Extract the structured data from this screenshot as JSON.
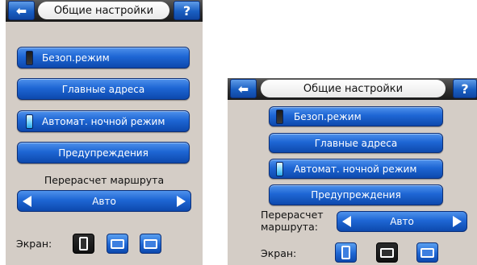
{
  "panel_a": {
    "title": "Общие настройки",
    "back_icon": "arrow-left-icon",
    "help_label": "?",
    "safe_mode_label": "Безоп.режим",
    "main_addresses_label": "Главные адреса",
    "night_mode_label": "Автомат. ночной режим",
    "warnings_label": "Предупреждения",
    "route_recalc_label": "Перерасчет маршрута",
    "route_recalc_value": "Авто",
    "screen_label": "Экран:"
  },
  "panel_b": {
    "title": "Общие настройки",
    "back_icon": "arrow-left-icon",
    "help_label": "?",
    "safe_mode_label": "Безоп.режим",
    "main_addresses_label": "Главные адреса",
    "night_mode_label": "Автомат. ночной режим",
    "warnings_label": "Предупреждения",
    "route_recalc_label_line1": "Перерасчет",
    "route_recalc_label_line2": "маршрута:",
    "route_recalc_value": "Авто",
    "screen_label": "Экран:"
  },
  "toggles": {
    "safe_mode": "off",
    "night_mode": "on"
  },
  "colors": {
    "button_blue": "#1e66d4",
    "background": "#d4cdc6",
    "titlebar": "#2f2f2f",
    "toggle_on": "#7fd8ff"
  },
  "icons": [
    "arrow-left-icon",
    "question-icon",
    "toggle-icon",
    "arrow-left-triangle-icon",
    "arrow-right-triangle-icon",
    "screen-portrait-icon",
    "screen-landscape-icon"
  ]
}
